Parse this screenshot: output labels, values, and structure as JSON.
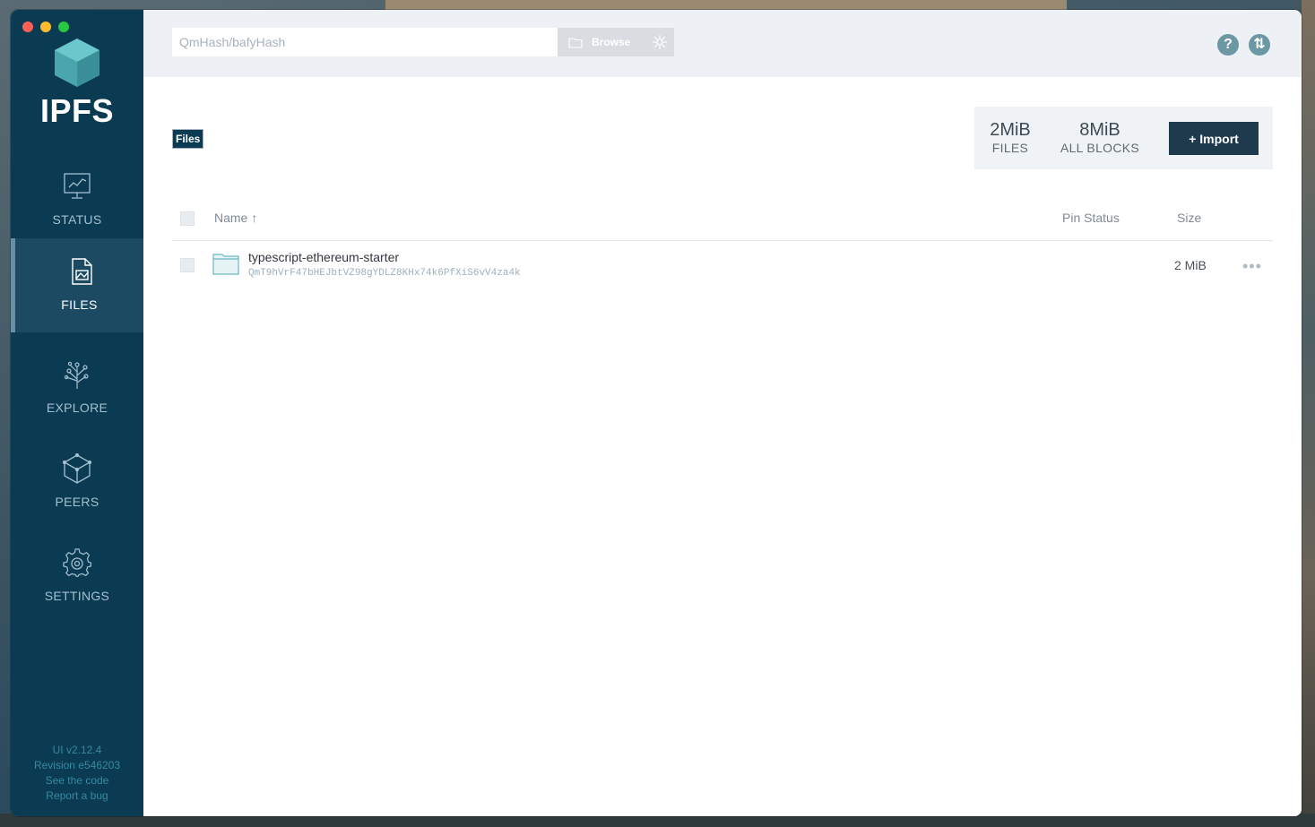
{
  "sidebar": {
    "logo_text": "IPFS",
    "items": [
      {
        "id": "status",
        "label": "STATUS",
        "icon": "status-icon",
        "active": false
      },
      {
        "id": "files",
        "label": "FILES",
        "icon": "files-icon",
        "active": true
      },
      {
        "id": "explore",
        "label": "EXPLORE",
        "icon": "explore-icon",
        "active": false
      },
      {
        "id": "peers",
        "label": "PEERS",
        "icon": "peers-icon",
        "active": false
      },
      {
        "id": "settings",
        "label": "SETTINGS",
        "icon": "settings-icon",
        "active": false
      }
    ],
    "footer": {
      "ui_version": "UI v2.12.4",
      "revision": "Revision e546203",
      "see_code": "See the code",
      "report_bug": "Report a bug"
    }
  },
  "topbar": {
    "search_placeholder": "QmHash/bafyHash",
    "browse_label": "Browse",
    "help_glyph": "?",
    "update_glyph": "⇅"
  },
  "files": {
    "breadcrumb": "Files",
    "stats": {
      "files_value": "2MiB",
      "files_label": "FILES",
      "blocks_value": "8MiB",
      "blocks_label": "ALL BLOCKS"
    },
    "import_label": "+ Import",
    "columns": {
      "name": "Name ↑",
      "pin_status": "Pin Status",
      "size": "Size"
    },
    "rows": [
      {
        "name": "typescript-ethereum-starter",
        "cid": "QmT9hVrF47bHEJbtVZ98gYDLZ8KHx74k6PfXiS6vV4za4k",
        "pin_status": "",
        "size": "2 MiB",
        "more": "•••"
      }
    ]
  },
  "colors": {
    "sidebar_bg": "#0b3a53",
    "accent": "#1f3a4d",
    "teal": "#6b98a3"
  }
}
